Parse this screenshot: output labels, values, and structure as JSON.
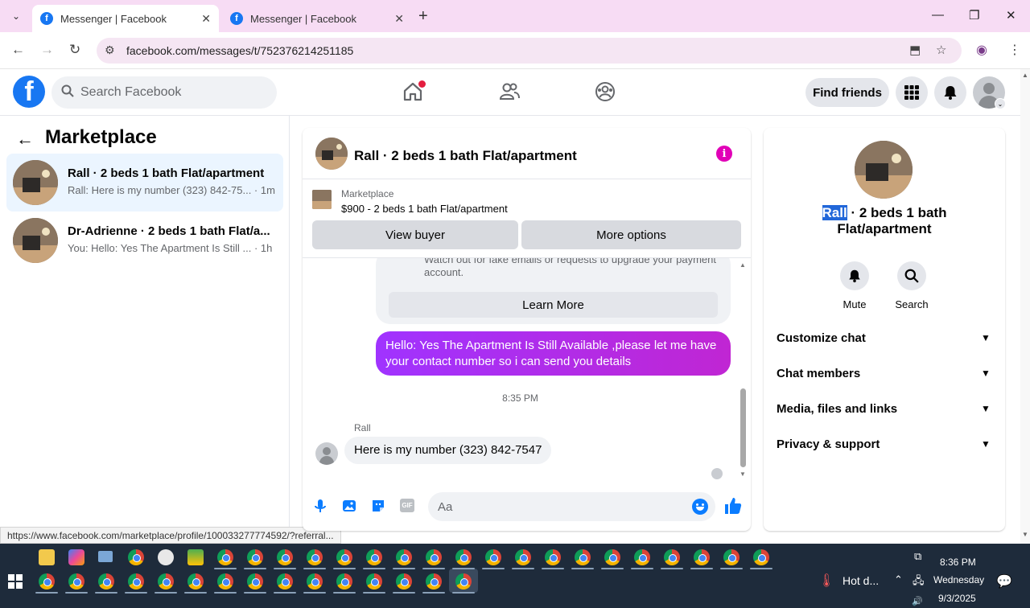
{
  "browser": {
    "tabs": [
      {
        "title": "Messenger | Facebook",
        "active": true
      },
      {
        "title": "Messenger | Facebook",
        "active": false
      }
    ],
    "url": "facebook.com/messages/t/752376214251185",
    "status_url": "https://www.facebook.com/marketplace/profile/100033277774592/?referral..."
  },
  "fb_header": {
    "logo": "f",
    "search_placeholder": "Search Facebook",
    "find_friends": "Find friends"
  },
  "left_panel": {
    "title": "Marketplace",
    "threads": [
      {
        "name": "Rall · 2 beds 1 bath Flat/apartment",
        "preview": "Rall: Here is my number (323) 842-75... · 1m",
        "selected": true
      },
      {
        "name": "Dr-Adrienne · 2 beds 1 bath Flat/a...",
        "preview": "You: Hello: Yes The Apartment Is Still ... · 1h",
        "selected": false
      }
    ]
  },
  "chat": {
    "title": "Rall · 2 beds 1 bath Flat/apartment",
    "marketplace_label": "Marketplace",
    "listing": "$900 - 2 beds 1 bath Flat/apartment",
    "view_buyer": "View buyer",
    "more_options": "More options",
    "warning_text": "Watch out for fake emails or requests to upgrade your payment account.",
    "learn_more": "Learn More",
    "outgoing_message": "Hello: Yes The Apartment Is Still Available ,please let me have your contact number so i can send you details",
    "timestamp": "8:35 PM",
    "sender_name": "Rall",
    "incoming_message": "Here is my number (323) 842-7547",
    "input_placeholder": "Aa",
    "gif_label": "GIF",
    "accent_color": "#a033ff"
  },
  "right_panel": {
    "name_highlight": "Rall",
    "name_rest": " · 2 beds 1 bath Flat/apartment",
    "actions": [
      {
        "label": "Mute",
        "icon": "bell-icon"
      },
      {
        "label": "Search",
        "icon": "search-icon"
      }
    ],
    "sections": [
      "Customize chat",
      "Chat members",
      "Media, files and links",
      "Privacy & support"
    ]
  },
  "taskbar": {
    "weather": "Hot d...",
    "time": "8:36 PM",
    "day": "Wednesday",
    "date": "9/3/2025"
  }
}
